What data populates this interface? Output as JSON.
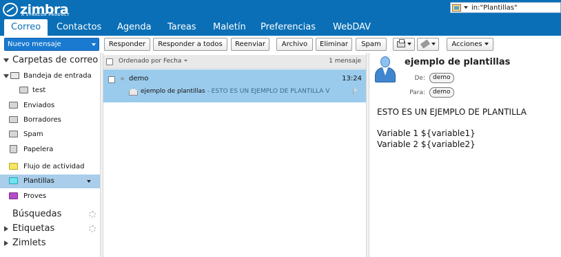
{
  "app": {
    "logo_text": "zimbra",
    "logo_sub": "A SYNACOR PRODUCT"
  },
  "search": {
    "value": "in:\"Plantillas\"",
    "type_icon": "mail-search-icon"
  },
  "tabs": [
    {
      "label": "Correo",
      "active": true
    },
    {
      "label": "Contactos"
    },
    {
      "label": "Agenda"
    },
    {
      "label": "Tareas"
    },
    {
      "label": "Maletín"
    },
    {
      "label": "Preferencias"
    },
    {
      "label": "WebDAV"
    }
  ],
  "toolbar": {
    "new_message": "Nuevo mensaje",
    "reply": "Responder",
    "reply_all": "Responder a todos",
    "forward": "Reenviar",
    "archive": "Archivo",
    "delete": "Eliminar",
    "spam": "Spam",
    "actions": "Acciones"
  },
  "sidebar": {
    "mail_folders_header": "Carpetas de correo",
    "folders": [
      {
        "label": "Bandeja de entrada",
        "icon": "inbox-icon"
      },
      {
        "label": "test",
        "icon": "folder-icon"
      },
      {
        "label": "Enviados",
        "icon": "sent-icon"
      },
      {
        "label": "Borradores",
        "icon": "drafts-icon"
      },
      {
        "label": "Spam",
        "icon": "spam-icon"
      },
      {
        "label": "Papelera",
        "icon": "trash-icon"
      },
      {
        "label": "Flujo de actividad",
        "icon": "folder-yellow-icon",
        "color": "#f5e663"
      },
      {
        "label": "Plantillas",
        "icon": "folder-cyan-icon",
        "color": "#6fe3f0",
        "selected": true
      },
      {
        "label": "Proves",
        "icon": "folder-purple-icon",
        "color": "#b44fc8"
      }
    ],
    "searches": "Búsquedas",
    "tags": "Etiquetas",
    "zimlets": "Zimlets"
  },
  "message_list": {
    "sort_label": "Ordenado por Fecha",
    "count": "1 mensaje",
    "messages": [
      {
        "sender": "demo",
        "time": "13:24",
        "subject": "ejemplo de plantillas",
        "fragment": " - ESTO ES UN EJEMPLO DE PLANTILLA V"
      }
    ]
  },
  "reader": {
    "subject": "ejemplo de plantillas",
    "from_label": "De:",
    "from": "demo",
    "to_label": "Para:",
    "to": "demo",
    "body_lines": [
      "ESTO ES UN EJEMPLO DE PLANTILLA",
      "Variable 1 ${variable1}",
      "Variable 2 ${variable2}"
    ]
  },
  "colors": {
    "header_blue": "#0a6fb6",
    "selection": "#9bcbec",
    "sidebar_selection": "#a9cdea"
  }
}
